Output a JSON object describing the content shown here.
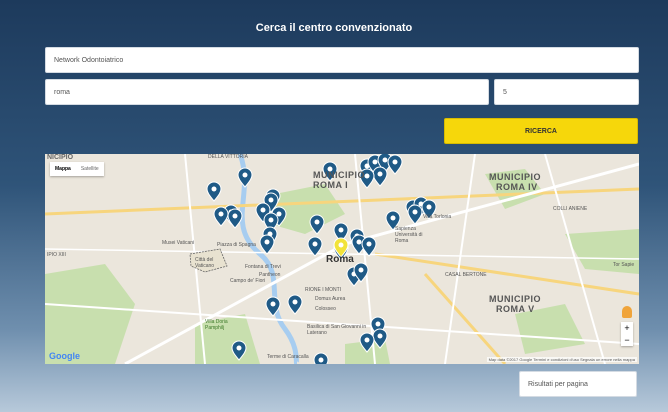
{
  "form": {
    "title": "Cerca il centro convenzionato",
    "network_value": "Network Odontoiatrico",
    "city_value": "roma",
    "radius_value": "5",
    "search_button": "RICERCA"
  },
  "map": {
    "toggle_map": "Mappa",
    "toggle_satellite": "Satellite",
    "labels": {
      "nicipio_top": "NICIPIO",
      "della_vittoria": "DELLA VITTORIA",
      "municipio_1": "MUNICIPIO",
      "roma_1": "ROMA I",
      "municipio_4": "MUNICIPIO",
      "roma_4": "ROMA IV",
      "municipio_5": "MUNICIPIO",
      "roma_5": "ROMA V",
      "roma": "Roma",
      "musei_vaticani": "Musei Vaticani",
      "citta_vaticano": "Città del Vaticano",
      "fontana_trevi": "Fontana di Trevi",
      "pantheon": "Pantheon",
      "campo_fiori": "Campo de' Fiori",
      "rione_monti": "RIONE I MONTI",
      "domus_aurea": "Domus Aurea",
      "colosseo": "Colosseo",
      "basilica": "Basilica di San Giovanni in Laterano",
      "villa_doria": "Villa Doria Pamphilj",
      "terme": "Terme di Caracalla",
      "sapienza": "Sapienza Università di Roma",
      "casal_bertone": "CASAL BERTONE",
      "colli_aniene": "COLLI ANIENE",
      "tor_sapienza": "Tor Sapie",
      "ipio": "IPIO XIII",
      "villa_torlonia": "Villa Torlonia",
      "piazza_spagna": "Piazza di Spagna"
    },
    "google": "Google",
    "attribution": "Map data ©2017 Google   Termini e condizioni d'uso   Segnala un errore nella mappa",
    "zoom_in": "+",
    "zoom_out": "−",
    "marker_color": "#1f5a86",
    "selected_marker_color": "#f2e33a"
  },
  "results": {
    "per_page_placeholder": "Risultati per pagina"
  }
}
